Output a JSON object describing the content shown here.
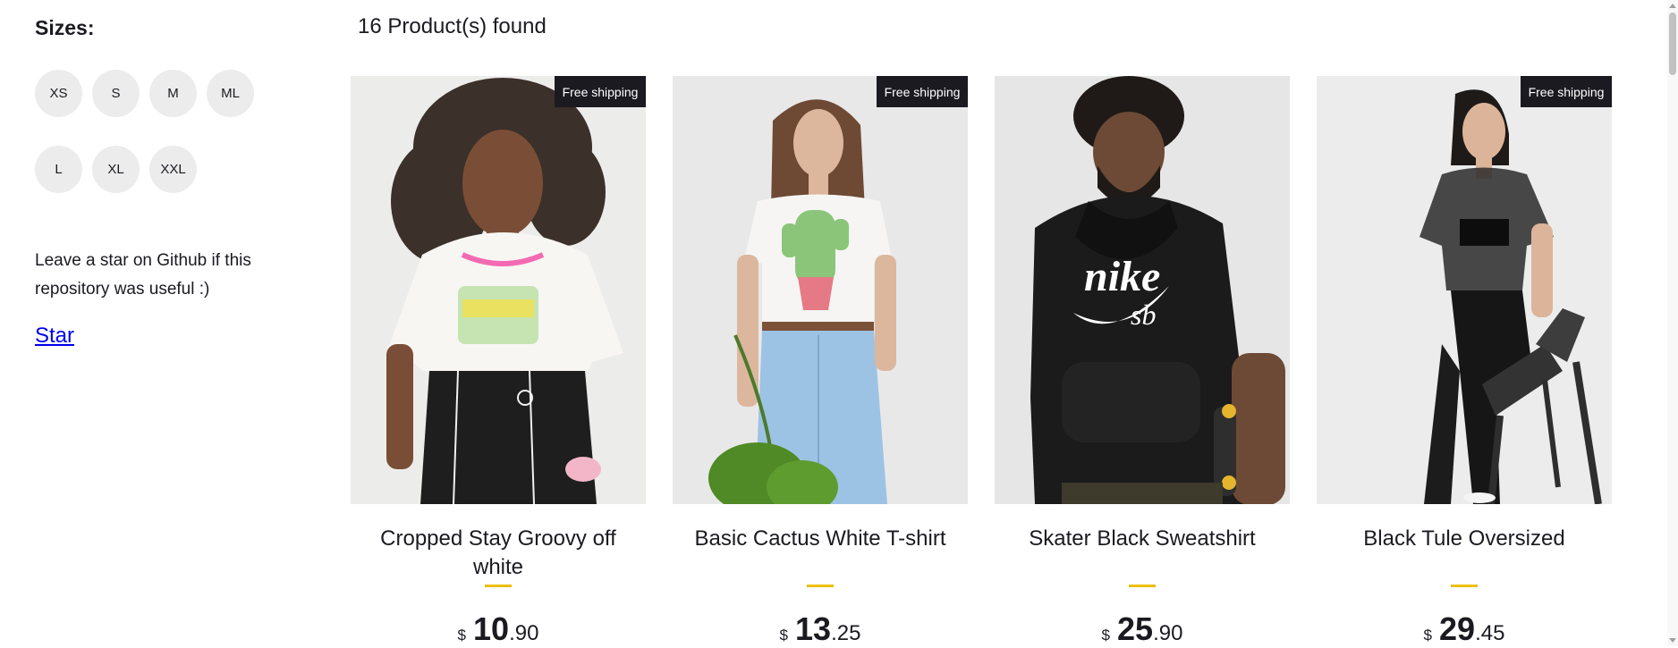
{
  "filters": {
    "title": "Sizes:",
    "sizes": [
      "XS",
      "S",
      "M",
      "ML",
      "L",
      "XL",
      "XXL"
    ]
  },
  "sidebar": {
    "help_text": "Leave a star on Github if this repository was useful :)",
    "star_link": "Star"
  },
  "results": {
    "count_text": "16 Product(s) found"
  },
  "products": [
    {
      "title": "Cropped Stay Groovy off white",
      "badge": "Free shipping",
      "currency": "$",
      "price_whole": "10",
      "price_cents": ".90"
    },
    {
      "title": "Basic Cactus White T-shirt",
      "badge": "Free shipping",
      "currency": "$",
      "price_whole": "13",
      "price_cents": ".25"
    },
    {
      "title": "Skater Black Sweatshirt",
      "badge": "",
      "currency": "$",
      "price_whole": "25",
      "price_cents": ".90"
    },
    {
      "title": "Black Tule Oversized",
      "badge": "Free shipping",
      "currency": "$",
      "price_whole": "29",
      "price_cents": ".45"
    }
  ],
  "colors": {
    "accent": "#eabf00",
    "badge_bg": "#1b1a20",
    "size_button_bg": "#ececec",
    "link": "#0000ee"
  }
}
